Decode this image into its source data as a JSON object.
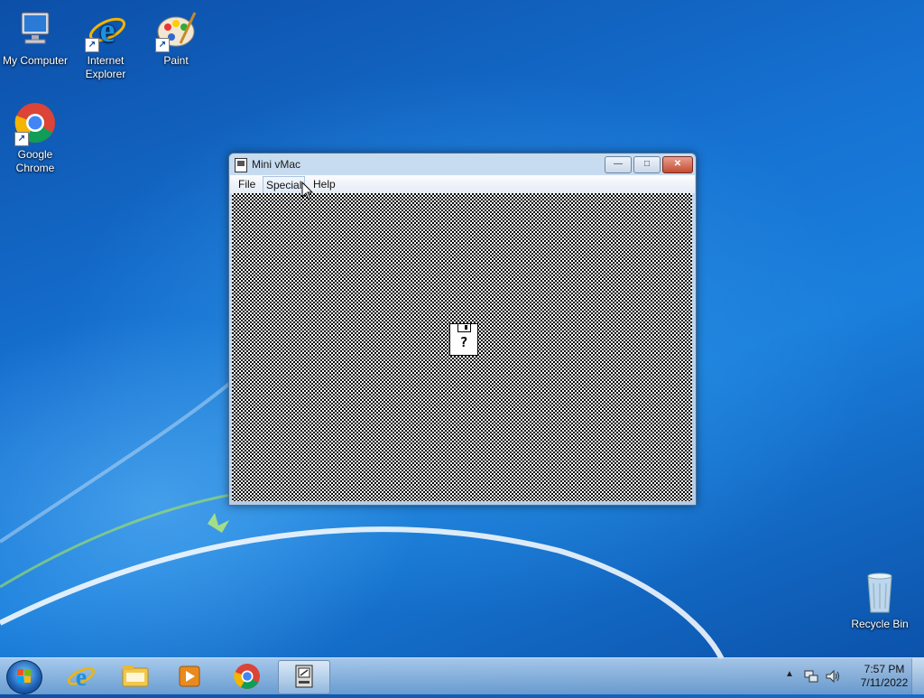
{
  "desktop": {
    "icons": [
      {
        "label": "My Computer"
      },
      {
        "label": "Internet Explorer"
      },
      {
        "label": "Paint"
      },
      {
        "label": "Google Chrome"
      },
      {
        "label": "Recycle Bin"
      }
    ]
  },
  "window": {
    "title": "Mini vMac",
    "buttons": {
      "minimize": "—",
      "maximize": "□",
      "close": "✕"
    },
    "menu": [
      {
        "label": "File"
      },
      {
        "label": "Special"
      },
      {
        "label": "Help"
      }
    ],
    "screen": {
      "disk_symbol": "?"
    }
  },
  "taskbar": {
    "pinned": [
      "Internet Explorer",
      "File Explorer",
      "Media Player",
      "Google Chrome",
      "Mini vMac"
    ],
    "tray": {
      "time": "7:57 PM",
      "date": "7/11/2022"
    }
  }
}
